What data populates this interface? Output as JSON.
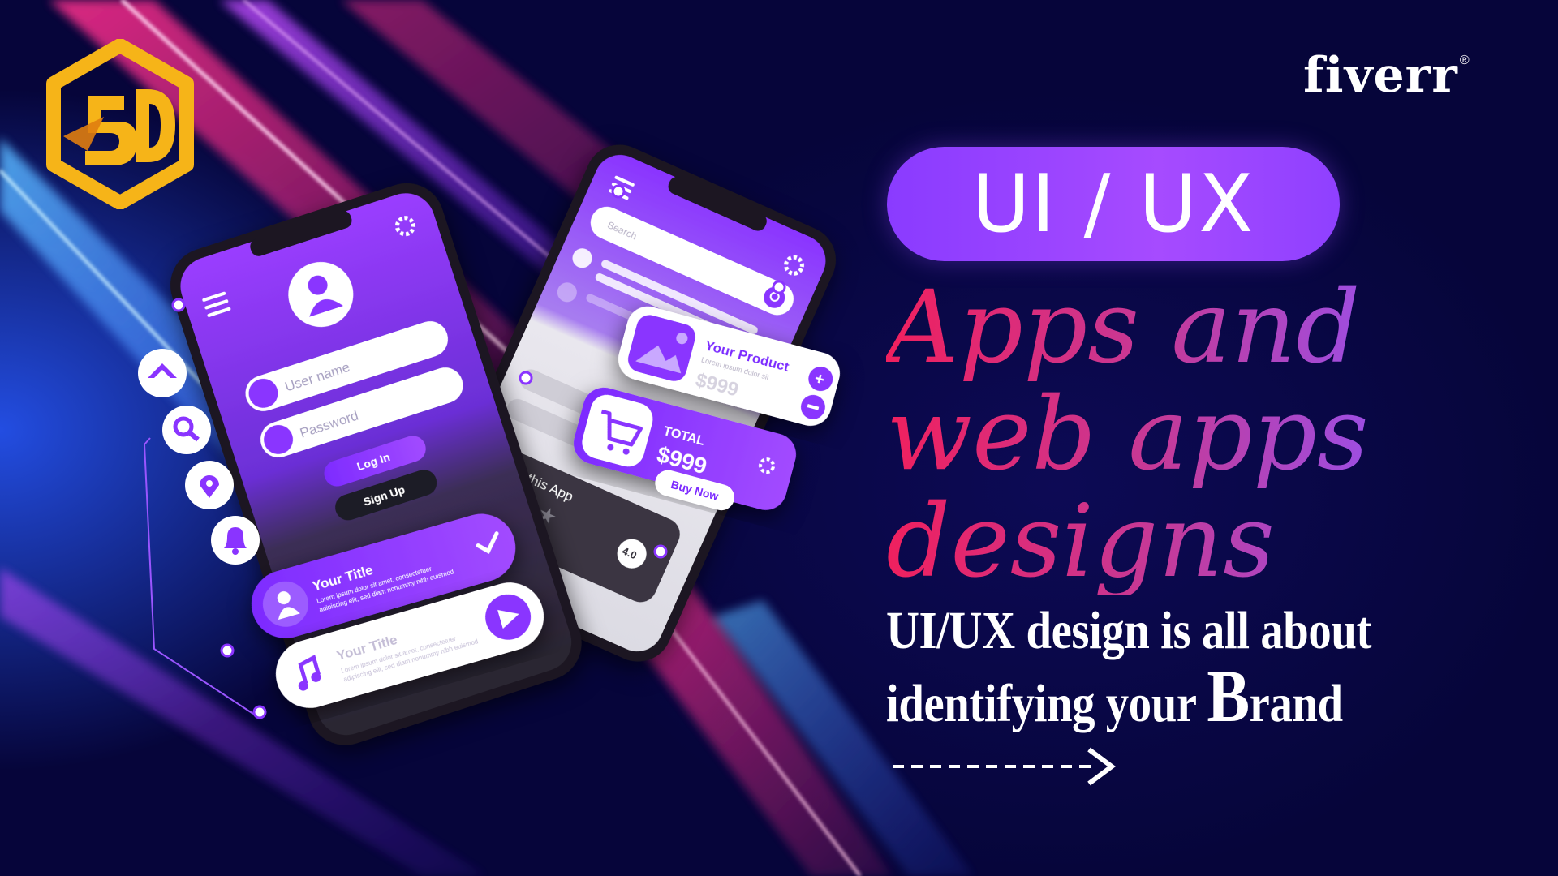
{
  "brand": {
    "logo_text": "5D",
    "fiverr": "fiverr",
    "registered": "®"
  },
  "badge": "UI / UX",
  "headline": {
    "line1": "Apps and",
    "line2": "web apps",
    "line3": "designs"
  },
  "subtitle": {
    "line1": "UI/UX design is all about",
    "line2_prefix": "identifying your ",
    "line2_big": "B",
    "line2_suffix": "rand"
  },
  "phone_left": {
    "username_placeholder": "User name",
    "password_placeholder": "Password",
    "login": "Log In",
    "signup": "Sign Up",
    "card1_title": "Your Title",
    "card1_text1": "Lorem ipsum dolor sit amet, consectetuer",
    "card1_text2": "adipiscing elit, sed diam nonummy nibh euismod",
    "card2_title": "Your Title",
    "card2_text1": "Lorem ipsum dolor sit amet, consectetuer",
    "card2_text2": "adipiscing elit, sed diam nonummy nibh euismod"
  },
  "phone_right": {
    "search_placeholder": "Search",
    "product_title": "Your Product",
    "product_desc": "Lorem ipsum dolor sit",
    "product_price": "$999",
    "total_label": "TOTAL",
    "total_value": "$999",
    "buy_now": "Buy Now",
    "rate_label": "Rate this App",
    "rating": "4.0"
  },
  "colors": {
    "accent": "#8f3dff",
    "bg": "#07063a",
    "pink": "#f0205e",
    "gold": "#f6b418"
  }
}
